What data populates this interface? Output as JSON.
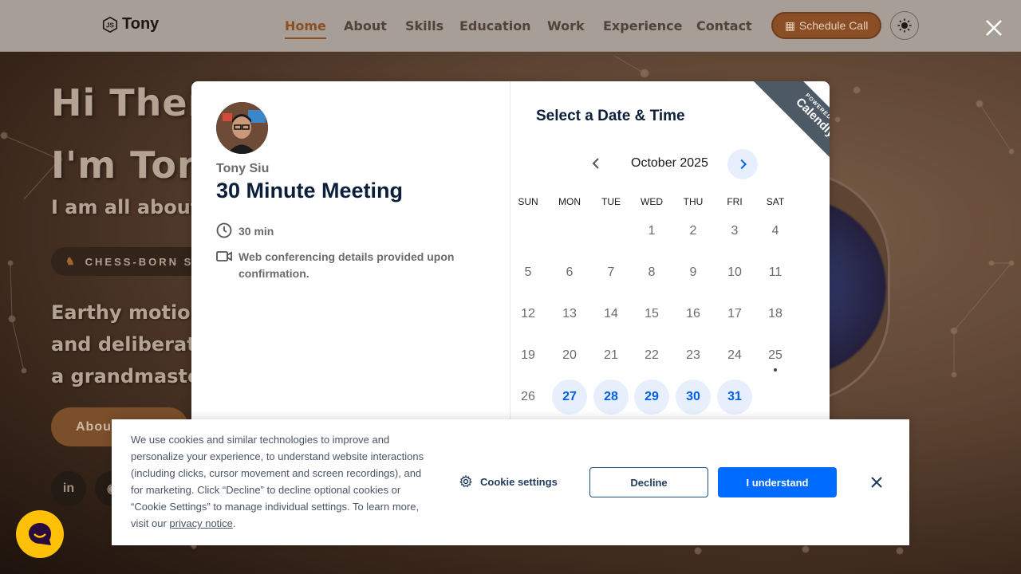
{
  "navbar": {
    "logo_text": "Tony",
    "links": [
      "Home",
      "About",
      "Skills",
      "Education",
      "Work",
      "Experience",
      "Contact"
    ],
    "active_link": "Home",
    "schedule_label": "Schedule Call"
  },
  "hero": {
    "line1": "Hi There",
    "line2": "I'm Ton",
    "sub": "I am all about",
    "badge": "CHESS-BORN ST",
    "text1": "Earthy motion",
    "text2": "and deliberat",
    "text3": "a grandmaste",
    "button": "About"
  },
  "modal": {
    "host_name": "Tony Siu",
    "event_title": "30 Minute Meeting",
    "duration": "30 min",
    "location_text": "Web conferencing details provided upon confirmation.",
    "select_title": "Select a Date & Time",
    "month_label": "October 2025",
    "weekdays": [
      "SUN",
      "MON",
      "TUE",
      "WED",
      "THU",
      "FRI",
      "SAT"
    ],
    "weeks": [
      [
        "",
        "",
        "",
        "1",
        "2",
        "3",
        "4"
      ],
      [
        "5",
        "6",
        "7",
        "8",
        "9",
        "10",
        "11"
      ],
      [
        "12",
        "13",
        "14",
        "15",
        "16",
        "17",
        "18"
      ],
      [
        "19",
        "20",
        "21",
        "22",
        "23",
        "24",
        "25"
      ],
      [
        "26",
        "27",
        "28",
        "29",
        "30",
        "31",
        ""
      ]
    ],
    "available_days": [
      "27",
      "28",
      "29",
      "30",
      "31"
    ],
    "today": "25",
    "ribbon_small": "POWERED BY",
    "ribbon_big": "Calendly"
  },
  "cookie": {
    "text": "We use cookies and similar technologies to improve and personalize your experience, to understand website interactions (including clicks, cursor movement and screen recordings), and for marketing. Click “Decline” to decline optional cookies or “Cookie Settings” to manage individual settings. To learn more, visit our",
    "link_text": "privacy notice",
    "link_suffix": ".",
    "settings_label": "Cookie settings",
    "decline_label": "Decline",
    "accept_label": "I understand"
  },
  "colors": {
    "accent_blue": "#006bff",
    "brand_brown": "#8b4f24",
    "navy": "#0b1f3a"
  }
}
